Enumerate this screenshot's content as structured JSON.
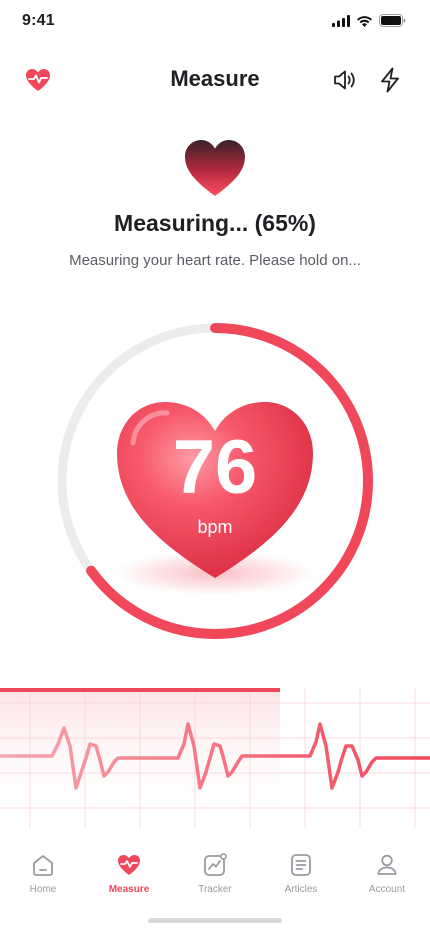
{
  "status": {
    "time": "9:41"
  },
  "header": {
    "title": "Measure"
  },
  "measure": {
    "title": "Measuring... (65%)",
    "subtitle": "Measuring your heart rate. Please hold on...",
    "progress_percent": 65,
    "bpm": "76",
    "unit": "bpm"
  },
  "colors": {
    "accent": "#f0485a",
    "track": "#ececec",
    "text": "#1f1f24"
  },
  "nav": {
    "items": [
      {
        "label": "Home",
        "icon": "home-icon"
      },
      {
        "label": "Measure",
        "icon": "heart-pulse-icon",
        "active": true
      },
      {
        "label": "Tracker",
        "icon": "chart-icon"
      },
      {
        "label": "Articles",
        "icon": "document-icon"
      },
      {
        "label": "Account",
        "icon": "user-icon"
      }
    ]
  }
}
